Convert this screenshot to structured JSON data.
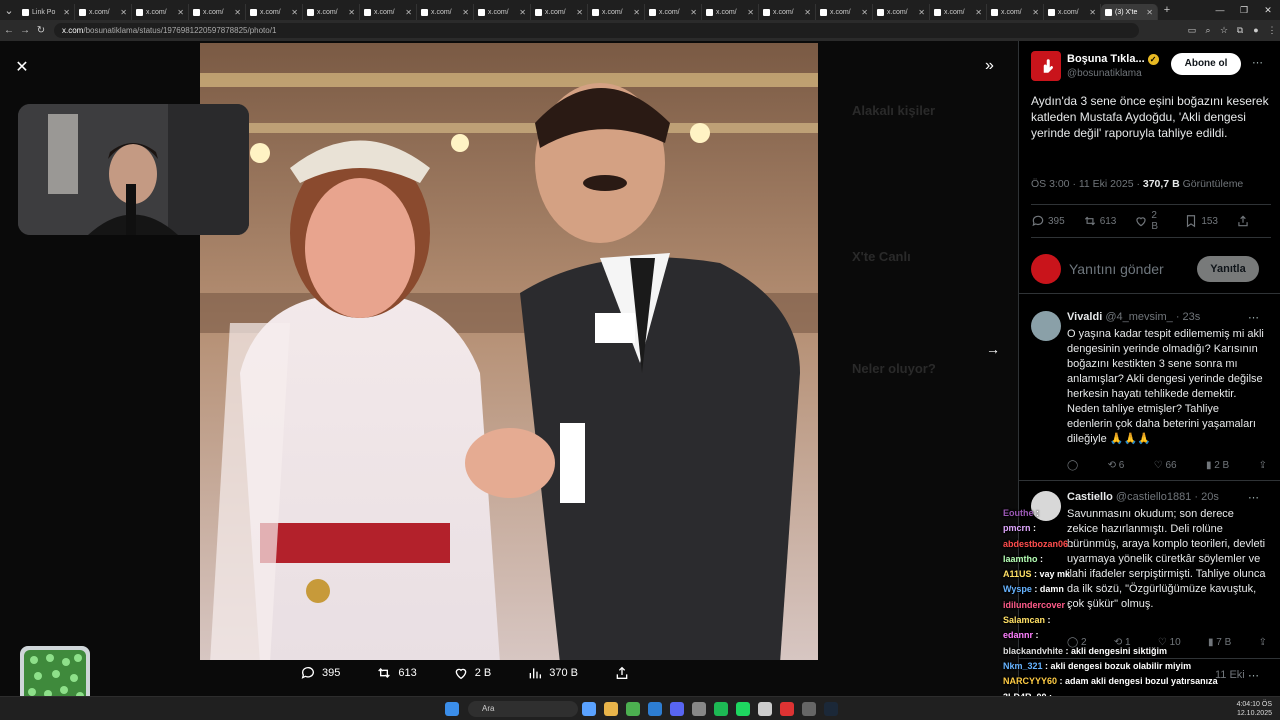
{
  "browser": {
    "tabs": [
      {
        "label": "Link Po",
        "active": false
      },
      {
        "label": "x.com/",
        "active": false
      },
      {
        "label": "x.com/",
        "active": false
      },
      {
        "label": "x.com/",
        "active": false
      },
      {
        "label": "x.com/",
        "active": false
      },
      {
        "label": "x.com/",
        "active": false
      },
      {
        "label": "x.com/",
        "active": false
      },
      {
        "label": "x.com/",
        "active": false
      },
      {
        "label": "x.com/",
        "active": false
      },
      {
        "label": "x.com/",
        "active": false
      },
      {
        "label": "x.com/",
        "active": false
      },
      {
        "label": "x.com/",
        "active": false
      },
      {
        "label": "x.com/",
        "active": false
      },
      {
        "label": "x.com/",
        "active": false
      },
      {
        "label": "x.com/",
        "active": false
      },
      {
        "label": "x.com/",
        "active": false
      },
      {
        "label": "x.com/",
        "active": false
      },
      {
        "label": "x.com/",
        "active": false
      },
      {
        "label": "x.com/",
        "active": false
      },
      {
        "label": "(3) X'te",
        "active": true
      }
    ],
    "url_domain": "x.com",
    "url_path": "/bosunatiklama/status/1976981220597878825/photo/1"
  },
  "viewer": {
    "actions": {
      "replies": "395",
      "reposts": "613",
      "likes": "2 B",
      "views": "370 B"
    },
    "background_ghost": {
      "related_title": "Alakalı kişiler",
      "live_title": "X'te Canlı",
      "trends_title": "Neler oluyor?"
    }
  },
  "post": {
    "author_name": "Boşuna Tıkla...",
    "author_handle": "@bosunatiklama",
    "subscribe_label": "Abone ol",
    "text": "Aydın'da 3 sene önce eşini boğazını keserek katleden Mustafa Aydoğdu, 'Akli dengesi yerinde değil' raporuyla tahliye edildi.",
    "time": "ÖS 3:00 · 11 Eki 2025 ·",
    "views": "370,7 B",
    "views_label": "Görüntüleme",
    "stats": {
      "replies": "395",
      "reposts": "613",
      "likes": "2 B",
      "bookmarks": "153"
    }
  },
  "compose": {
    "placeholder": "Yanıtını gönder",
    "button": "Yanıtla"
  },
  "replies": [
    {
      "name": "Vivaldi",
      "handle": "@4_mevsim_",
      "time": "· 23s",
      "text": "O yaşına kadar tespit edilememiş mi akli dengesinin yerinde olmadığı? Karısının boğazını kestikten 3 sene sonra mı anlamışlar? Akli dengesi yerinde değilse herkesin hayatı tehlikede demektir. Neden tahliye etmişler? Tahliye edenlerin çok daha beterini yaşamaları dileğiyle 🙏🙏🙏",
      "reposts": "6",
      "likes": "66",
      "views": "2 B"
    },
    {
      "name": "Castiello",
      "handle": "@castiello1881",
      "time": "· 20s",
      "text": "Savunmasını okudum; son derece zekice hazırlanmıştı. Deli rolüne bürünmüş, araya komplo teorileri, devleti uyarmaya yönelik cüretkâr söylemler ve ilahi ifadeler serpiştirmişti. Tahliye olunca da ilk sözü, \"Özgürlüğümüze kavuştuk, çok şükür\" olmuş.",
      "replies": "2",
      "reposts": "1",
      "likes": "10",
      "views": "7 B"
    },
    {
      "name": "",
      "handle": "",
      "time": "11 Eki",
      "text": ""
    }
  ],
  "chat": [
    {
      "user": "Eouthe",
      "msg": "",
      "color": "#9b59b6"
    },
    {
      "user": "pmcrn",
      "msg": "",
      "color": "#e0a8ff"
    },
    {
      "user": "abdestbozan06",
      "msg": "",
      "color": "#ff4d4d"
    },
    {
      "user": "Iaamtho",
      "msg": "",
      "color": "#b5ffb5"
    },
    {
      "user": "A11US",
      "msg": "vay mk",
      "color": "#ffe066"
    },
    {
      "user": "Wyspe",
      "msg": "damn",
      "color": "#66b3ff"
    },
    {
      "user": "idilundercover",
      "msg": "",
      "color": "#ff5c8a"
    },
    {
      "user": "Salamcan",
      "msg": "",
      "color": "#ffe066"
    },
    {
      "user": "edannr",
      "msg": "",
      "color": "#ff80ff"
    },
    {
      "user": "blackandvhite",
      "msg": "akli dengesini siktiğim",
      "color": "#dddddd"
    },
    {
      "user": "Nkm_321",
      "msg": "akli dengesi bozuk olabilir miyim",
      "color": "#66b3ff"
    },
    {
      "user": "NARCYYY60",
      "msg": "adam akli dengesi bozul yatırsanıza",
      "color": "#ffcc44"
    },
    {
      "user": "3LD4R_00",
      "msg": "",
      "color": "#ffffff"
    }
  ],
  "taskbar": {
    "search": "Ara",
    "time": "4:04:10 ÖS",
    "date": "12.10.2025"
  }
}
